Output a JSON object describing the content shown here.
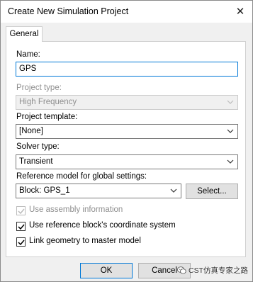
{
  "window": {
    "title": "Create New Simulation Project",
    "close_glyph": "✕"
  },
  "tabs": [
    {
      "label": "General"
    }
  ],
  "name": {
    "label": "Name:",
    "value": "GPS"
  },
  "project_type": {
    "label": "Project type:",
    "value": "High Frequency"
  },
  "project_template": {
    "label": "Project template:",
    "value": "[None]"
  },
  "solver_type": {
    "label": "Solver type:",
    "value": "Transient"
  },
  "reference_model": {
    "label": "Reference model for global settings:",
    "value": "Block: GPS_1",
    "select_button": "Select..."
  },
  "checkboxes": [
    {
      "label": "Use assembly information",
      "checked": true,
      "disabled": true
    },
    {
      "label": "Use reference block's coordinate system",
      "checked": true,
      "disabled": false
    },
    {
      "label": "Link geometry to master model",
      "checked": true,
      "disabled": false
    }
  ],
  "buttons": {
    "ok": "OK",
    "cancel": "Cancel"
  },
  "watermark": {
    "text": "CST仿真专家之路",
    "icon": "wechat-icon"
  },
  "colors": {
    "focus": "#0078d7",
    "disabled_text": "#8f8f8f"
  }
}
